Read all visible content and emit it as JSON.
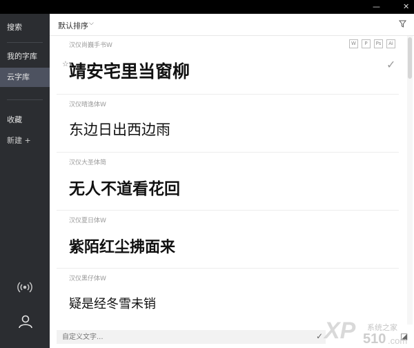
{
  "window": {
    "minimize": "—",
    "maximize": "□",
    "close": "✕"
  },
  "sidebar": {
    "search": "搜索",
    "my_library": "我的字库",
    "cloud_library": "云字库",
    "favorites": "收藏",
    "new": "新建 +"
  },
  "toolbar": {
    "sort_label": "默认排序",
    "sort_caret": "⌵"
  },
  "formats": [
    "W",
    "P",
    "Ps",
    "Ai"
  ],
  "fonts": [
    {
      "name": "汉仪尚巍手书W",
      "preview": "靖安宅里当窗柳",
      "size": 25,
      "weight": "bold"
    },
    {
      "name": "汉仪晴逸体W",
      "preview": "东边日出西边雨",
      "size": 21,
      "weight": "normal"
    },
    {
      "name": "汉仪大圣体简",
      "preview": "无人不道看花回",
      "size": 23,
      "weight": "bold"
    },
    {
      "name": "汉仪夏日体W",
      "preview": "紫陌红尘拂面来",
      "size": 22,
      "weight": "bold"
    },
    {
      "name": "汉仪黑仔体W",
      "preview": "疑是经冬雪未销",
      "size": 18,
      "weight": "normal"
    }
  ],
  "custom_text": {
    "placeholder": "自定义文字..."
  },
  "watermark": {
    "brand": "XP",
    "site": "系统之家",
    "domain": "510",
    "suffix": ".com"
  }
}
